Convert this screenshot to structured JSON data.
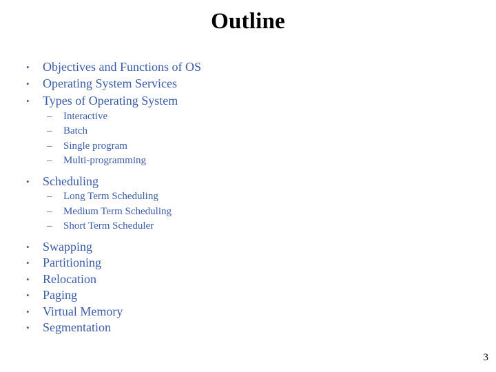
{
  "slide": {
    "title": "Outline",
    "page_number": "3",
    "background_color": "#ffffff",
    "title_color": "#000000",
    "body_color": "#3A5BA8",
    "bullet_marker_level1": "•",
    "bullet_marker_level2": "–"
  },
  "outline": [
    {
      "level": 1,
      "text": "Objectives and Functions of OS"
    },
    {
      "level": 1,
      "text": "Operating System Services"
    },
    {
      "level": 1,
      "text": "Types of Operating System"
    },
    {
      "level": 2,
      "text": "Interactive"
    },
    {
      "level": 2,
      "text": "Batch"
    },
    {
      "level": 2,
      "text": "Single program"
    },
    {
      "level": 2,
      "text": "Multi-programming"
    },
    {
      "level": 1,
      "text": "Scheduling"
    },
    {
      "level": 2,
      "text": "Long Term Scheduling"
    },
    {
      "level": 2,
      "text": "Medium Term Scheduling"
    },
    {
      "level": 2,
      "text": "Short Term Scheduler"
    },
    {
      "level": 1,
      "text": "Swapping"
    },
    {
      "level": 1,
      "text": "Partitioning"
    },
    {
      "level": 1,
      "text": "Relocation"
    },
    {
      "level": 1,
      "text": "Paging"
    },
    {
      "level": 1,
      "text": "Virtual Memory"
    },
    {
      "level": 1,
      "text": "Segmentation"
    }
  ]
}
